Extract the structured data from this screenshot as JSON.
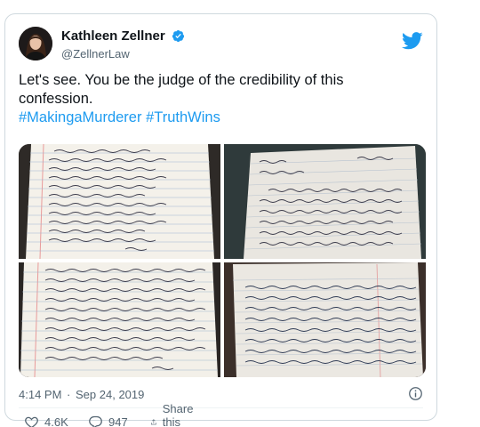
{
  "author": {
    "display_name": "Kathleen Zellner",
    "handle": "@ZellnerLaw"
  },
  "tweet": {
    "text_line1": "Let's see. You be the judge of the credibility  of this",
    "text_line2": "confession.",
    "hashtag1": "#MakingaMurderer",
    "hashtag2": "#TruthWins"
  },
  "meta": {
    "time": "4:14 PM",
    "separator": "·",
    "date": "Sep 24, 2019"
  },
  "actions": {
    "like_count": "4.6K",
    "reply_count": "947",
    "share_label": "Share this Tweet"
  },
  "colors": {
    "accent": "#1d9bf0",
    "text": "#0f1419",
    "secondary": "#536471",
    "like_red": "#f91880"
  },
  "icons": [
    "verified-badge-icon",
    "twitter-bird-icon",
    "info-icon",
    "heart-icon",
    "reply-icon",
    "share-icon"
  ]
}
